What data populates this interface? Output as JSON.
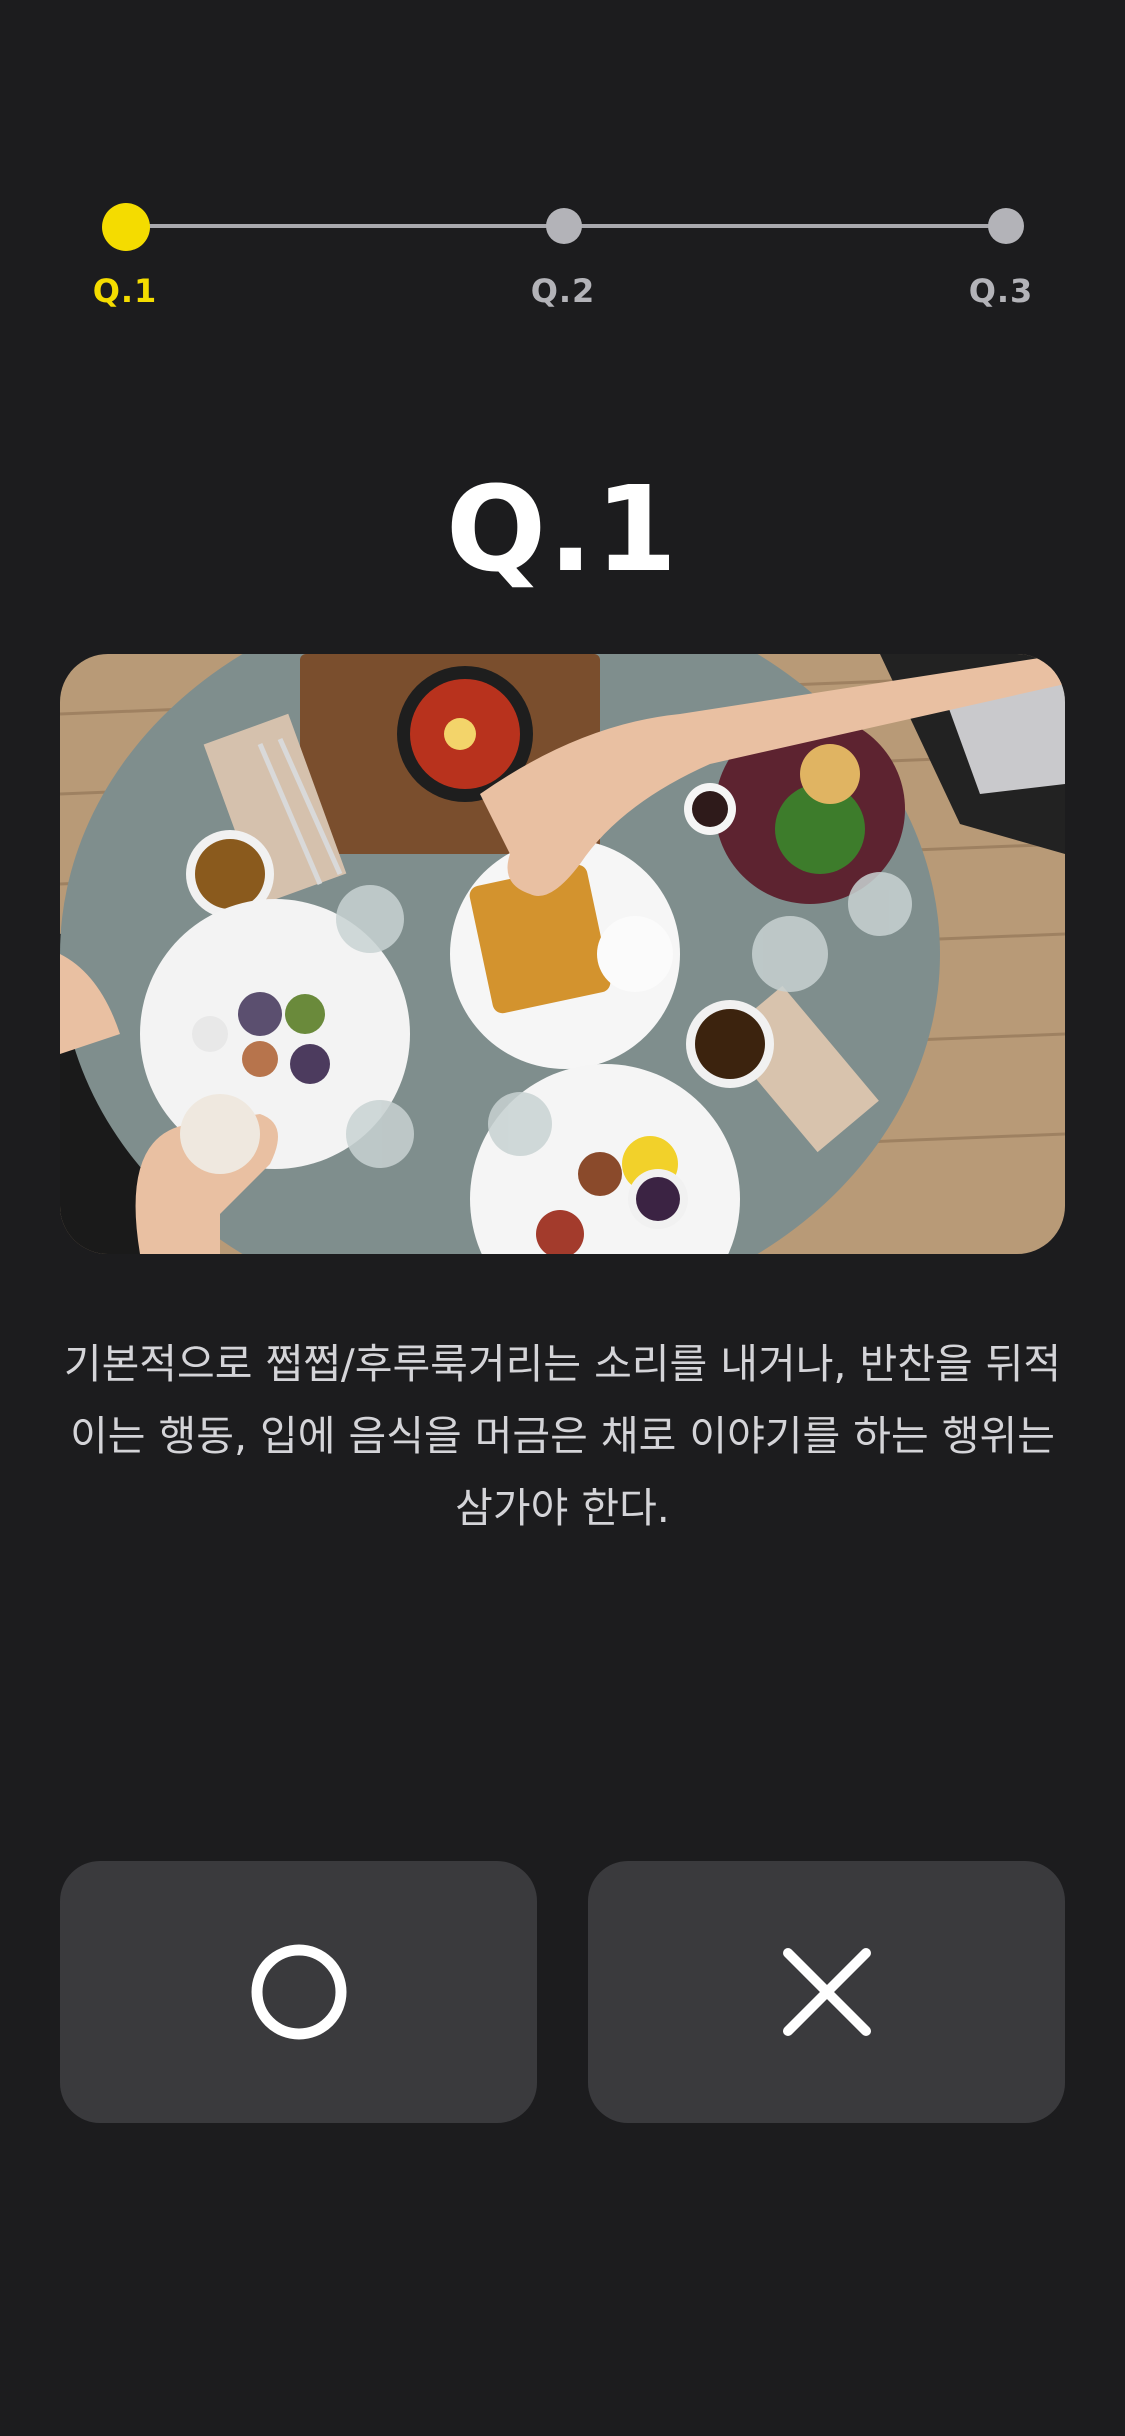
{
  "progress": {
    "steps": [
      {
        "label": "Q.1",
        "active": true
      },
      {
        "label": "Q.2",
        "active": false
      },
      {
        "label": "Q.3",
        "active": false
      }
    ]
  },
  "question": {
    "title": "Q.1",
    "description": "기본적으로 쩝쩝/후루룩거리는 소리를 내거나, 반찬을 뒤적이는 행동, 입에 음식을 머금은 채로 이야기를 하는 행위는 삼가야 한다."
  },
  "image": {
    "subject": "dining-table-photo"
  },
  "answers": {
    "o_icon": "circle-o-icon",
    "x_icon": "cross-x-icon"
  },
  "colors": {
    "background": "#1c1c1e",
    "accent": "#f4dc00",
    "inactive": "#b3b3b8",
    "button": "#3a3a3d"
  }
}
